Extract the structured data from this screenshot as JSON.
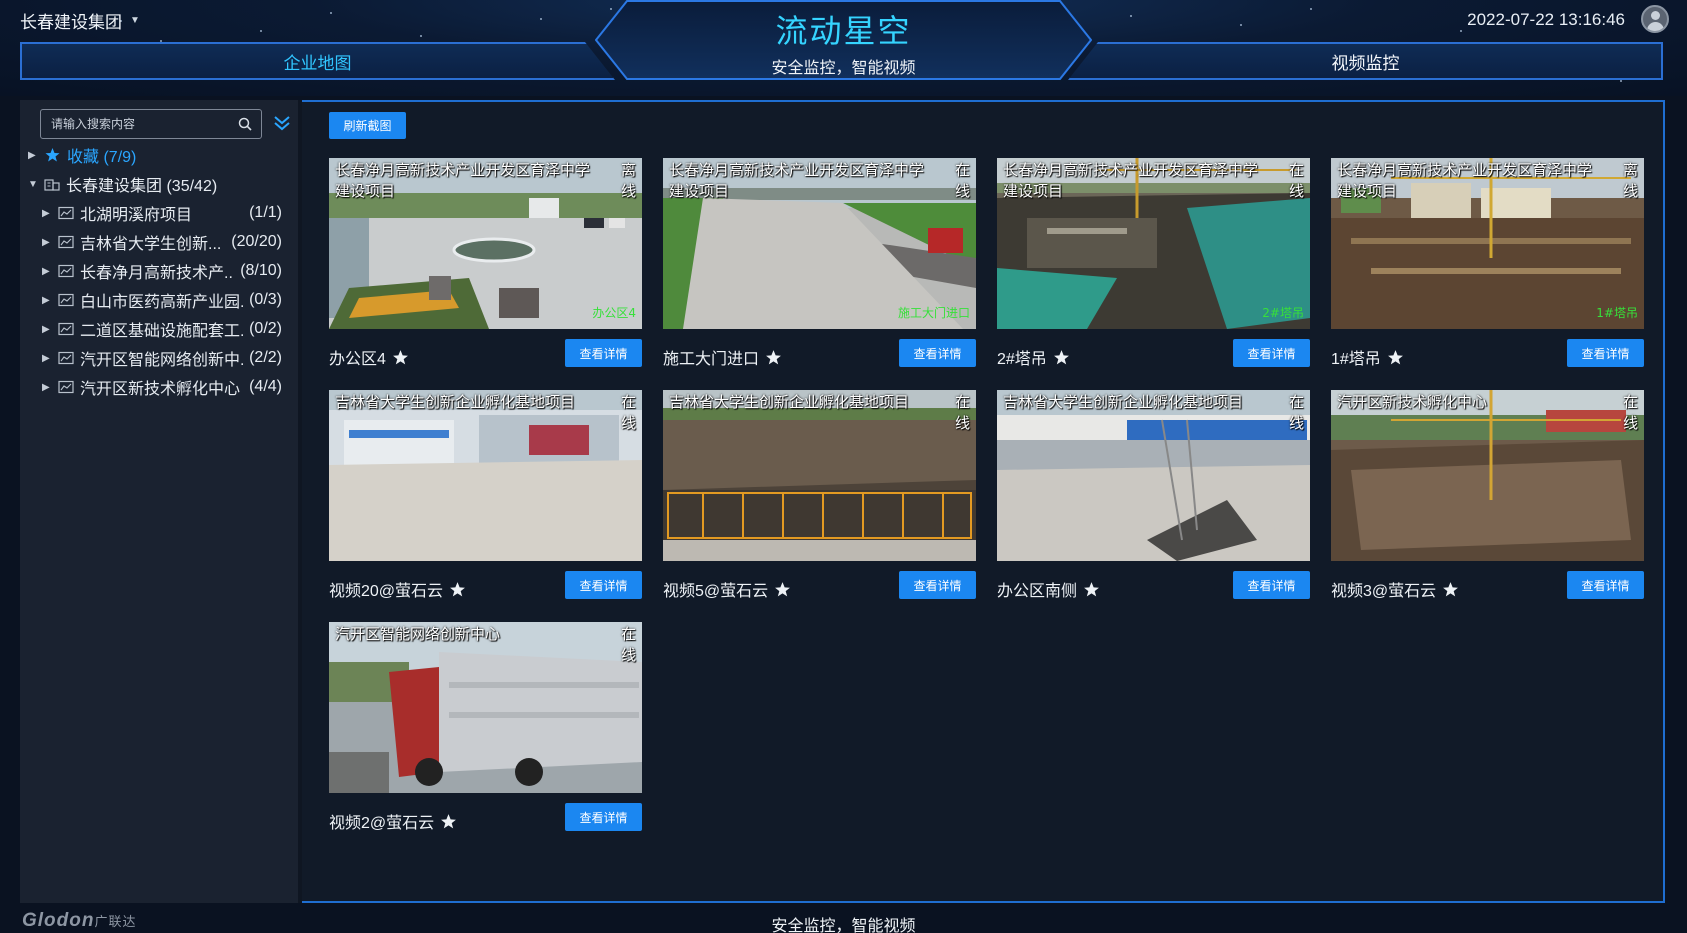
{
  "header": {
    "company": "长春建设集团",
    "title": "流动星空",
    "subtitle": "安全监控，智能视频",
    "datetime": "2022-07-22 13:16:46",
    "nav_left": "企业地图",
    "nav_right": "视频监控"
  },
  "sidebar": {
    "search_placeholder": "请输入搜索内容",
    "favorites": {
      "label": "收藏",
      "count": "(7/9)"
    },
    "group": {
      "label": "长春建设集团",
      "count": "(35/42)"
    },
    "projects": [
      {
        "label": "北湖明溪府项目",
        "count": "(1/1)"
      },
      {
        "label": "吉林省大学生创新...",
        "count": "(20/20)"
      },
      {
        "label": "长春净月高新技术产...",
        "count": "(8/10)"
      },
      {
        "label": "白山市医药高新产业园...",
        "count": "(0/3)"
      },
      {
        "label": "二道区基础设施配套工...",
        "count": "(0/2)"
      },
      {
        "label": "汽开区智能网络创新中...",
        "count": "(2/2)"
      },
      {
        "label": "汽开区新技术孵化中心",
        "count": "(4/4)"
      }
    ]
  },
  "toolbar": {
    "refresh": "刷新截图"
  },
  "detail_label": "查看详情",
  "cameras": [
    {
      "project": "长春净月高新技术产业开发区育泽中学建设项目",
      "status": "离线",
      "name": "办公区4",
      "osd": "办公区4",
      "scene": "plaza"
    },
    {
      "project": "长春净月高新技术产业开发区育泽中学建设项目",
      "status": "在线",
      "name": "施工大门进口",
      "osd": "施工大门进口",
      "scene": "gate"
    },
    {
      "project": "长春净月高新技术产业开发区育泽中学建设项目",
      "status": "在线",
      "name": "2#塔吊",
      "osd": "2#塔吊",
      "scene": "site"
    },
    {
      "project": "长春净月高新技术产业开发区育泽中学建设项目",
      "status": "离线",
      "name": "1#塔吊",
      "osd": "1#塔吊",
      "scene": "site2"
    },
    {
      "project": "吉林省大学生创新企业孵化基地项目",
      "status": "在线",
      "name": "视频20@萤石云",
      "osd": "",
      "scene": "yard"
    },
    {
      "project": "吉林省大学生创新企业孵化基地项目",
      "status": "在线",
      "name": "视频5@萤石云",
      "osd": "",
      "scene": "dirt"
    },
    {
      "project": "吉林省大学生创新企业孵化基地项目",
      "status": "在线",
      "name": "办公区南侧",
      "osd": "",
      "scene": "office"
    },
    {
      "project": "汽开区新技术孵化中心",
      "status": "在线",
      "name": "视频3@萤石云",
      "osd": "",
      "scene": "aerial"
    },
    {
      "project": "汽开区智能网络创新中心",
      "status": "在线",
      "name": "视频2@萤石云",
      "osd": "",
      "scene": "truck"
    }
  ],
  "footer": {
    "logo": "Glodon",
    "logo_cn": "广联达",
    "text": "安全监控，智能视频"
  },
  "colors": {
    "accent": "#1b87f1",
    "title": "#35d4ff",
    "frame": "#1f6ed1",
    "favorite": "#2aa6ff"
  }
}
